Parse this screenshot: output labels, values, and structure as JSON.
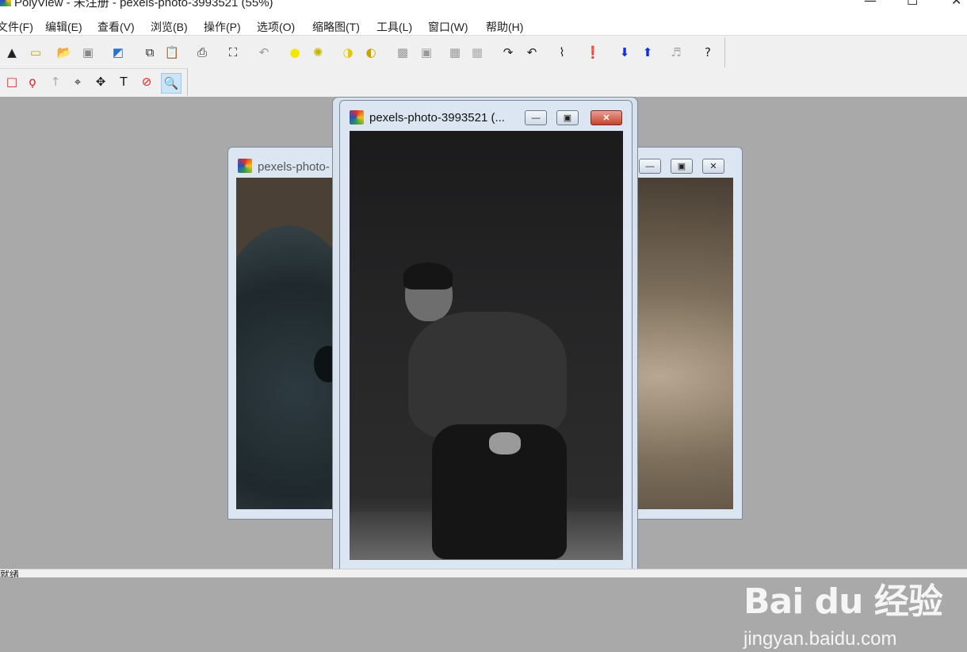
{
  "window": {
    "title": "PolyView - 未注册 - pexels-photo-3993521 (55%)",
    "minimize": "—",
    "maximize": "☐",
    "close": "✕"
  },
  "menu": [
    "文件(F)",
    "编辑(E)",
    "查看(V)",
    "浏览(B)",
    "操作(P)",
    "选项(O)",
    "缩略图(T)",
    "工具(L)",
    "窗口(W)",
    "帮助(H)"
  ],
  "toolbar1": [
    {
      "name": "acquire-icon",
      "glyph": "▲",
      "color": "#222"
    },
    {
      "name": "new-icon",
      "glyph": "▭",
      "color": "#c8a400"
    },
    {
      "name": "open-folder-icon",
      "glyph": "📂",
      "color": "#c8a400"
    },
    {
      "name": "save-icon",
      "glyph": "▣",
      "color": "#888"
    },
    {
      "name": "color-adjust-icon",
      "glyph": "◩",
      "color": "#2a70d0"
    },
    {
      "name": "copy-icon",
      "glyph": "⧉",
      "color": "#222"
    },
    {
      "name": "paste-icon",
      "glyph": "📋",
      "color": "#222"
    },
    {
      "name": "print-icon",
      "glyph": "⎙",
      "color": "#222"
    },
    {
      "name": "fit-window-icon",
      "glyph": "⛶",
      "color": "#222"
    },
    {
      "name": "undo-icon",
      "glyph": "↶",
      "color": "#999"
    },
    {
      "name": "brightness-up-icon",
      "glyph": "●",
      "color": "#f5e600"
    },
    {
      "name": "brightness-down-icon",
      "glyph": "✺",
      "color": "#c8b400"
    },
    {
      "name": "contrast-up-icon",
      "glyph": "◑",
      "color": "#e6c800"
    },
    {
      "name": "contrast-down-icon",
      "glyph": "◐",
      "color": "#c8a400"
    },
    {
      "name": "dither-icon",
      "glyph": "▩",
      "color": "#999"
    },
    {
      "name": "frame-icon",
      "glyph": "▣",
      "color": "#999"
    },
    {
      "name": "grid-icon",
      "glyph": "▦",
      "color": "#999"
    },
    {
      "name": "grid-alt-icon",
      "glyph": "▦",
      "color": "#aaa"
    },
    {
      "name": "rotate-right-icon",
      "glyph": "↷",
      "color": "#222"
    },
    {
      "name": "rotate-left-icon",
      "glyph": "↶",
      "color": "#222"
    },
    {
      "name": "histogram-icon",
      "glyph": "⌇",
      "color": "#222"
    },
    {
      "name": "info-icon",
      "glyph": "❗",
      "color": "#999"
    },
    {
      "name": "next-down-icon",
      "glyph": "⬇",
      "color": "#1030e0"
    },
    {
      "name": "prev-up-icon",
      "glyph": "⬆",
      "color": "#1030e0"
    },
    {
      "name": "music-icon",
      "glyph": "♬",
      "color": "#aaa"
    },
    {
      "name": "help-icon",
      "glyph": "?",
      "color": "#222"
    }
  ],
  "toolbar2": [
    {
      "name": "rect-select-icon",
      "glyph": "□",
      "color": "#e02020"
    },
    {
      "name": "lasso-select-icon",
      "glyph": "ϙ",
      "color": "#e02020"
    },
    {
      "name": "arrow-tool-icon",
      "glyph": "↑",
      "color": "#aaa"
    },
    {
      "name": "crop-tool-icon",
      "glyph": "⌖",
      "color": "#222"
    },
    {
      "name": "move-tool-icon",
      "glyph": "✥",
      "color": "#222"
    },
    {
      "name": "text-tool-icon",
      "glyph": "T",
      "color": "#111"
    },
    {
      "name": "redeye-tool-icon",
      "glyph": "⊘",
      "color": "#e02020"
    },
    {
      "name": "zoom-tool-icon",
      "glyph": "🔍",
      "color": "#222"
    }
  ],
  "children": [
    {
      "title": "pexels-photo-3993521 (...",
      "minimize": "—",
      "restore": "▣",
      "close": "✕"
    },
    {
      "title": "pexels-photo-",
      "minimize": "—",
      "restore": "▣",
      "close": "✕"
    }
  ],
  "status": "就绪",
  "watermark": {
    "logo": "Bai du 经验",
    "url": "jingyan.baidu.com"
  }
}
